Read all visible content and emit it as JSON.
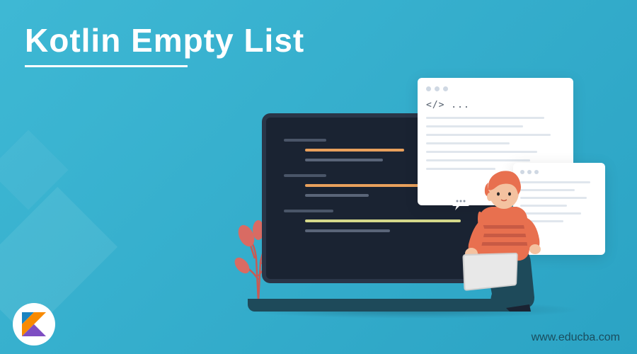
{
  "title": "Kotlin Empty List",
  "website_url": "www.educba.com",
  "code_window": {
    "tag_text": "</> ..."
  },
  "logo": {
    "name": "kotlin-logo"
  }
}
